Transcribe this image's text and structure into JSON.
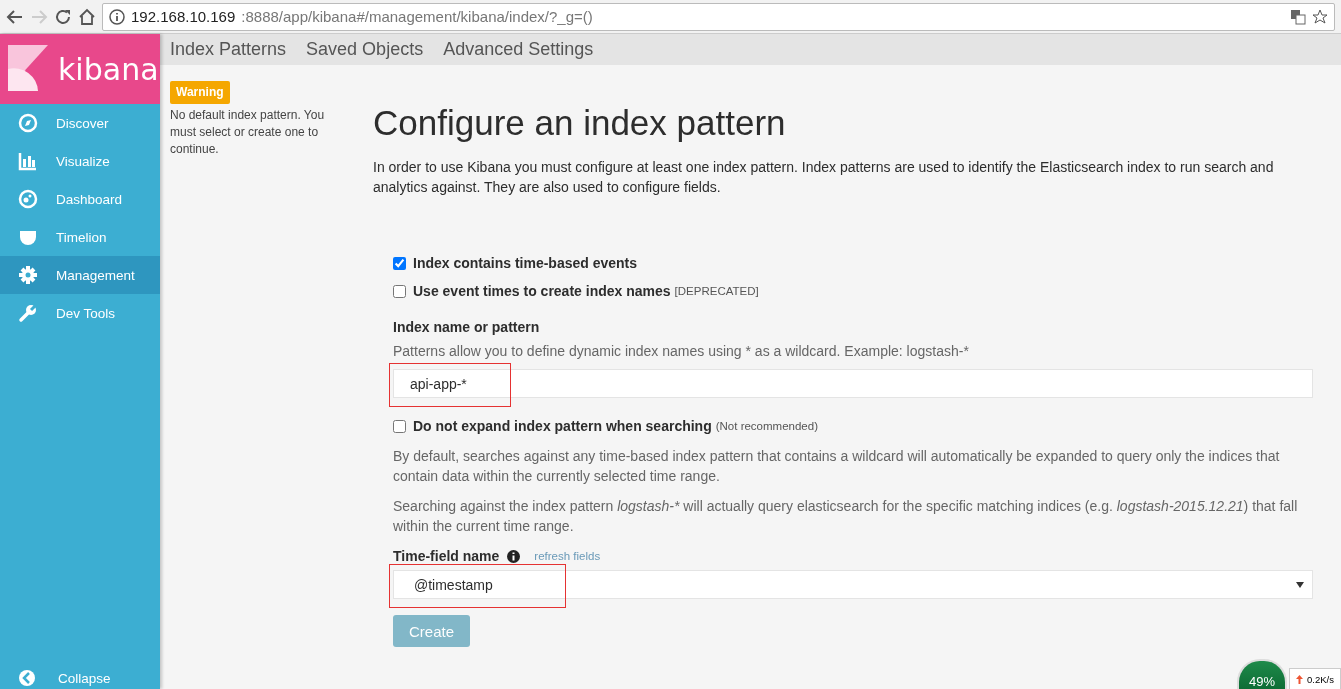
{
  "browser": {
    "url_host": "192.168.10.169",
    "url_rest": ":8888/app/kibana#/management/kibana/index/?_g=()"
  },
  "sidebar": {
    "logo": "kibana",
    "items": [
      {
        "label": "Discover",
        "selected": false
      },
      {
        "label": "Visualize",
        "selected": false
      },
      {
        "label": "Dashboard",
        "selected": false
      },
      {
        "label": "Timelion",
        "selected": false
      },
      {
        "label": "Management",
        "selected": true
      },
      {
        "label": "Dev Tools",
        "selected": false
      }
    ],
    "collapse": "Collapse"
  },
  "tabs": [
    {
      "label": "Index Patterns"
    },
    {
      "label": "Saved Objects"
    },
    {
      "label": "Advanced Settings"
    }
  ],
  "warning": {
    "badge": "Warning",
    "text": "No default index pattern. You must select or create one to continue."
  },
  "page": {
    "title": "Configure an index pattern",
    "intro": "In order to use Kibana you must configure at least one index pattern. Index patterns are used to identify the Elasticsearch index to run search and analytics against. They are also used to configure fields."
  },
  "form": {
    "time_based": {
      "label": "Index contains time-based events",
      "checked": true
    },
    "event_times": {
      "label": "Use event times to create index names",
      "note": "[DEPRECATED]",
      "checked": false
    },
    "name_label": "Index name or pattern",
    "name_help": "Patterns allow you to define dynamic index names using * as a wildcard. Example: logstash-*",
    "name_value": "api-app-*",
    "name_highlighted": true,
    "no_expand": {
      "label": "Do not expand index pattern when searching",
      "note": "(Not recommended)",
      "checked": false
    },
    "expand_help": "By default, searches against any time-based index pattern that contains a wildcard will automatically be expanded to query only the indices that contain data within the currently selected time range.",
    "search_help": [
      {
        "text": "Searching against the index pattern ",
        "italic": false
      },
      {
        "text": "logstash-*",
        "italic": true
      },
      {
        "text": " will actually query elasticsearch for the specific matching indices (e.g. ",
        "italic": false
      },
      {
        "text": "logstash-2015.12.21",
        "italic": true
      },
      {
        "text": ") that fall within the current time range.",
        "italic": false
      }
    ],
    "time_label": "Time-field name",
    "refresh": "refresh fields",
    "time_value": "@timestamp",
    "time_highlighted": true,
    "create": "Create",
    "create_disabled": true
  },
  "speed_widget": {
    "percent": "49%",
    "upload": "0.2K/s"
  }
}
